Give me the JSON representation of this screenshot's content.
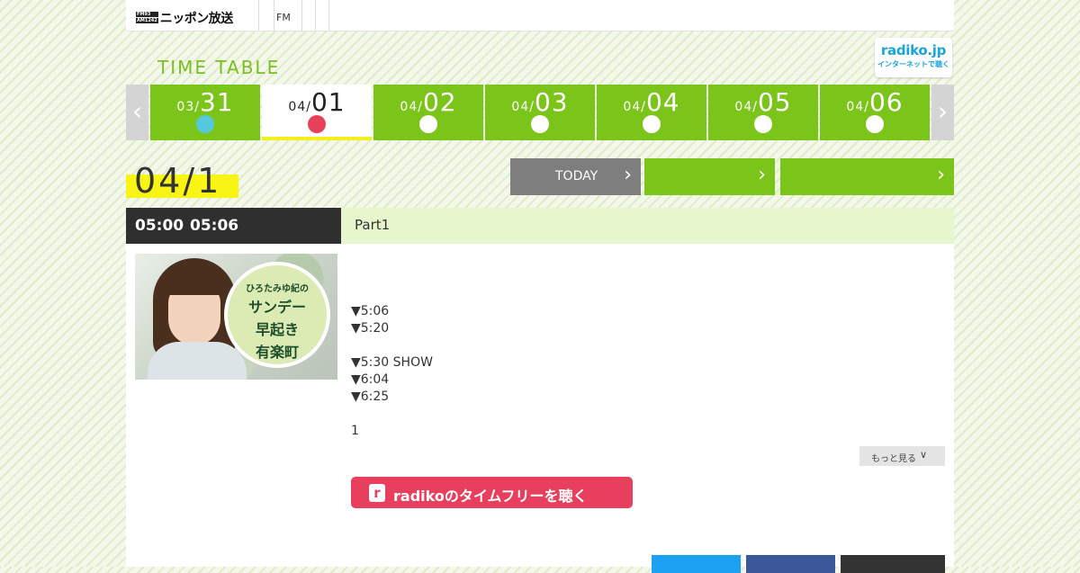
{
  "header": {
    "logo_mark_top": "FM93",
    "logo_mark_bottom": "AM1242",
    "logo_text": "ニッポン放送",
    "nav_fm": "FM"
  },
  "timetable_title": "TIME TABLE",
  "radiko_badge": {
    "line1": "radiko.jp",
    "line2": "インターネットで聴く"
  },
  "date_tabs": [
    {
      "month": "03/",
      "day": "31",
      "dot_color": "#55c8dd",
      "active": false
    },
    {
      "month": "04/",
      "day": "01",
      "dot_color": "#e8405a",
      "active": true
    },
    {
      "month": "04/",
      "day": "02",
      "dot_color": "#ffffff",
      "active": false
    },
    {
      "month": "04/",
      "day": "03",
      "dot_color": "#ffffff",
      "active": false
    },
    {
      "month": "04/",
      "day": "04",
      "dot_color": "#ffffff",
      "active": false
    },
    {
      "month": "04/",
      "day": "05",
      "dot_color": "#ffffff",
      "active": false
    },
    {
      "month": "04/",
      "day": "06",
      "dot_color": "#ffffff",
      "active": false
    }
  ],
  "selected_date": "04/1",
  "buttons": {
    "today": "TODAY"
  },
  "program": {
    "start": "05:00",
    "end": "05:06",
    "title": "Part1",
    "logo_line1": "ひろたみゆ紀の",
    "logo_line2": "サンデー",
    "logo_line3": "早起き",
    "logo_line4": "有楽町",
    "lines": [
      "▼5:06",
      "▼5:20",
      "",
      "▼5:30 SHOW",
      "▼6:04",
      "▼6:25",
      "",
      "1"
    ],
    "more_label": "もっと見る",
    "radiko_label": "radikoのタイムフリーを聴く"
  },
  "colors": {
    "brand_green": "#7bc41a",
    "highlight_yellow": "#f8f514",
    "radiko_pink": "#e73f5d",
    "radiko_blue": "#1aa5d9"
  }
}
